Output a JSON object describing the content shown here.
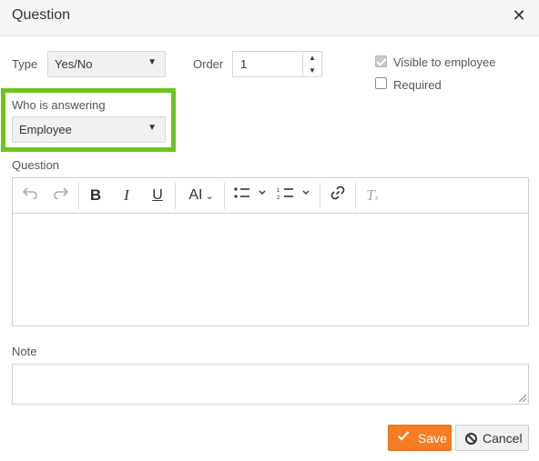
{
  "dialog": {
    "title": "Question",
    "close_glyph": "✕"
  },
  "type_field": {
    "label": "Type",
    "value": "Yes/No"
  },
  "order_field": {
    "label": "Order",
    "value": "1"
  },
  "visible_to_employee": {
    "label": "Visible to employee",
    "checked": true,
    "disabled": true
  },
  "required": {
    "label": "Required",
    "checked": false
  },
  "who_is_answering": {
    "label": "Who is answering",
    "value": "Employee",
    "highlight_color": "#6cc51c"
  },
  "question_field": {
    "label": "Question",
    "content": ""
  },
  "toolbar_icons": [
    "undo-icon",
    "redo-icon",
    "bold-icon",
    "italic-icon",
    "underline-icon",
    "font-size-icon",
    "bulleted-list-icon",
    "numbered-list-icon",
    "link-icon",
    "clear-formatting-icon"
  ],
  "note_field": {
    "label": "Note",
    "value": ""
  },
  "buttons": {
    "save": "Save",
    "cancel": "Cancel"
  },
  "colors": {
    "save_button": "#f57c22",
    "title_bar": "#f5f5f5"
  }
}
